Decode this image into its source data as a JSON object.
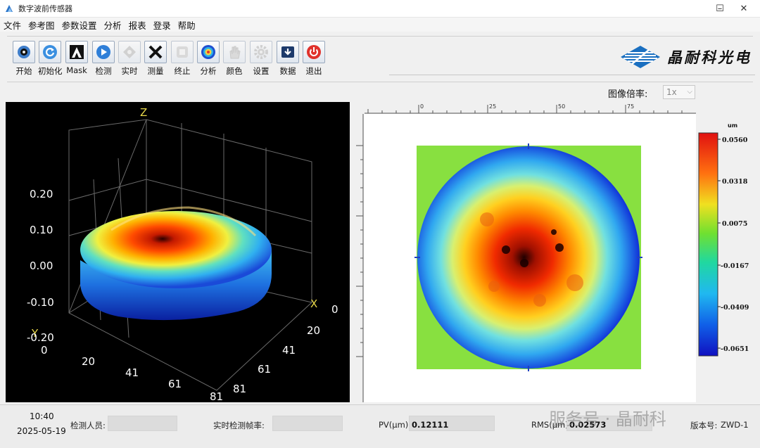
{
  "window": {
    "title": "数字波前传感器",
    "controls": {
      "minimize": "–",
      "maximize": "☐",
      "close": "✕"
    }
  },
  "menu": [
    "文件",
    "参考图",
    "参数设置",
    "分析",
    "报表",
    "登录",
    "帮助"
  ],
  "toolbar": {
    "buttons": [
      {
        "label": "开始",
        "icon": "record-icon"
      },
      {
        "label": "初始化",
        "icon": "refresh-icon"
      },
      {
        "label": "Mask",
        "icon": "mask-icon"
      },
      {
        "label": "检测",
        "icon": "play-icon"
      },
      {
        "label": "实时",
        "icon": "crosshair-icon"
      },
      {
        "label": "测量",
        "icon": "cross-icon"
      },
      {
        "label": "终止",
        "icon": "stop-icon"
      },
      {
        "label": "分析",
        "icon": "target-icon"
      },
      {
        "label": "颜色",
        "icon": "hand-icon"
      },
      {
        "label": "设置",
        "icon": "gear-icon"
      },
      {
        "label": "数据",
        "icon": "download-icon"
      },
      {
        "label": "退出",
        "icon": "power-icon"
      }
    ],
    "brand": "晶耐科光电"
  },
  "zoom": {
    "label": "图像倍率:",
    "value": "1x"
  },
  "plot3d": {
    "axis_labels": {
      "z": "Z",
      "x": "X",
      "y": "Y"
    },
    "z_ticks": [
      "0.20",
      "0.10",
      "0.00",
      "-0.10",
      "-0.20"
    ],
    "x_ticks": [
      "0",
      "20",
      "41",
      "61",
      "81"
    ],
    "y_ticks": [
      "0",
      "20",
      "41",
      "61",
      "81"
    ]
  },
  "ruler": {
    "ticks": [
      "0",
      "25",
      "50",
      "75"
    ]
  },
  "colorbar": {
    "unit": "um",
    "ticks": [
      "0.0560",
      "0.0318",
      "0.0075",
      "-0.0167",
      "-0.0409",
      "-0.0651"
    ]
  },
  "status": {
    "time": "10:40",
    "date": "2025-05-19",
    "inspector_label": "检测人员:",
    "inspector_value": "",
    "framerate_label": "实时检测帧率:",
    "framerate_value": "",
    "pv_label": "PV(μm):",
    "pv_value": "0.12111",
    "rms_label": "RMS(μm):",
    "rms_value": "0.02573",
    "version_label": "版本号:",
    "version_value": "ZWD-1"
  },
  "watermark": "服务号 · 晶耐科"
}
